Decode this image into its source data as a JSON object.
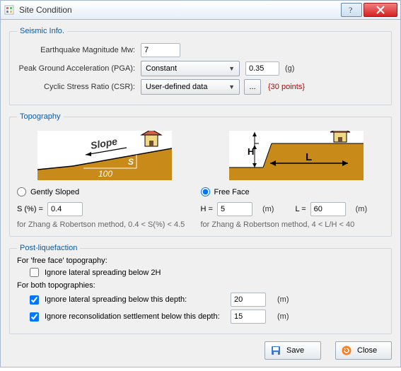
{
  "window": {
    "title": "Site Condition"
  },
  "seismic": {
    "legend": "Seismic Info.",
    "mw_label": "Earthquake Magnitude Mw:",
    "mw_value": "7",
    "pga_label": "Peak Ground Acceleration (PGA):",
    "pga_mode": "Constant",
    "pga_value": "0.35",
    "pga_unit": "(g)",
    "csr_label": "Cyclic Stress Ratio (CSR):",
    "csr_mode": "User-defined data",
    "csr_more": "...",
    "csr_points": "{30 points}"
  },
  "topography": {
    "legend": "Topography",
    "gently_label": "Gently Sloped",
    "freeface_label": "Free Face",
    "selected": "freeface",
    "s_label": "S (%) =",
    "s_value": "0.4",
    "s_hint": "for Zhang & Robertson method, 0.4 < S(%) < 4.5",
    "h_label": "H =",
    "h_value": "5",
    "h_unit": "(m)",
    "l_label": "L =",
    "l_value": "60",
    "l_unit": "(m)",
    "ff_hint": "for Zhang & Robertson method, 4 < L/H < 40",
    "fig1": {
      "slope": "Slope",
      "s": "S",
      "hund": "100"
    },
    "fig2": {
      "h": "H",
      "l": "L"
    }
  },
  "postliq": {
    "legend": "Post-liquefaction",
    "ff_heading": "For 'free face' topography:",
    "ignore_2h": "Ignore lateral spreading below 2H",
    "both_heading": "For both topographies:",
    "lateral_label": "Ignore lateral spreading below this depth:",
    "lateral_value": "20",
    "reconsol_label": "Ignore reconsolidation settlement below this depth:",
    "reconsol_value": "15",
    "unit": "(m)"
  },
  "buttons": {
    "save": "Save",
    "close": "Close"
  }
}
